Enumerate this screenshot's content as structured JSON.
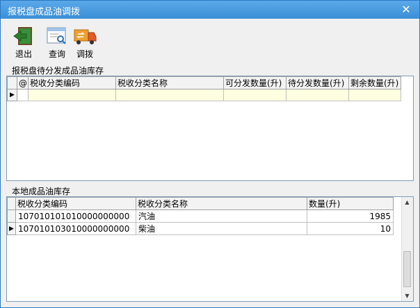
{
  "window": {
    "title": "报税盘成品油调拨",
    "close_glyph": "✕"
  },
  "toolbar": {
    "exit_label": "退出",
    "query_label": "查询",
    "transfer_label": "调拨"
  },
  "upper": {
    "legend": "报税盘待分发成品油库存",
    "headers": {
      "at": "@",
      "code": "税收分类编码",
      "name": "税收分类名称",
      "available": "可分发数量(升)",
      "pending": "待分发数量(升)",
      "remaining": "剩余数量(升)"
    }
  },
  "lower": {
    "legend": "本地成品油库存",
    "headers": {
      "code": "税收分类编码",
      "name": "税收分类名称",
      "qty": "数量(升)"
    },
    "rows": [
      {
        "code": "107010101010000000000",
        "name": "汽油",
        "qty": "1985"
      },
      {
        "code": "107010103010000000000",
        "name": "柴油",
        "qty": "10"
      }
    ]
  },
  "colors": {
    "titlebar": "#3b8fd6",
    "row_highlight": "#ffffe1"
  }
}
